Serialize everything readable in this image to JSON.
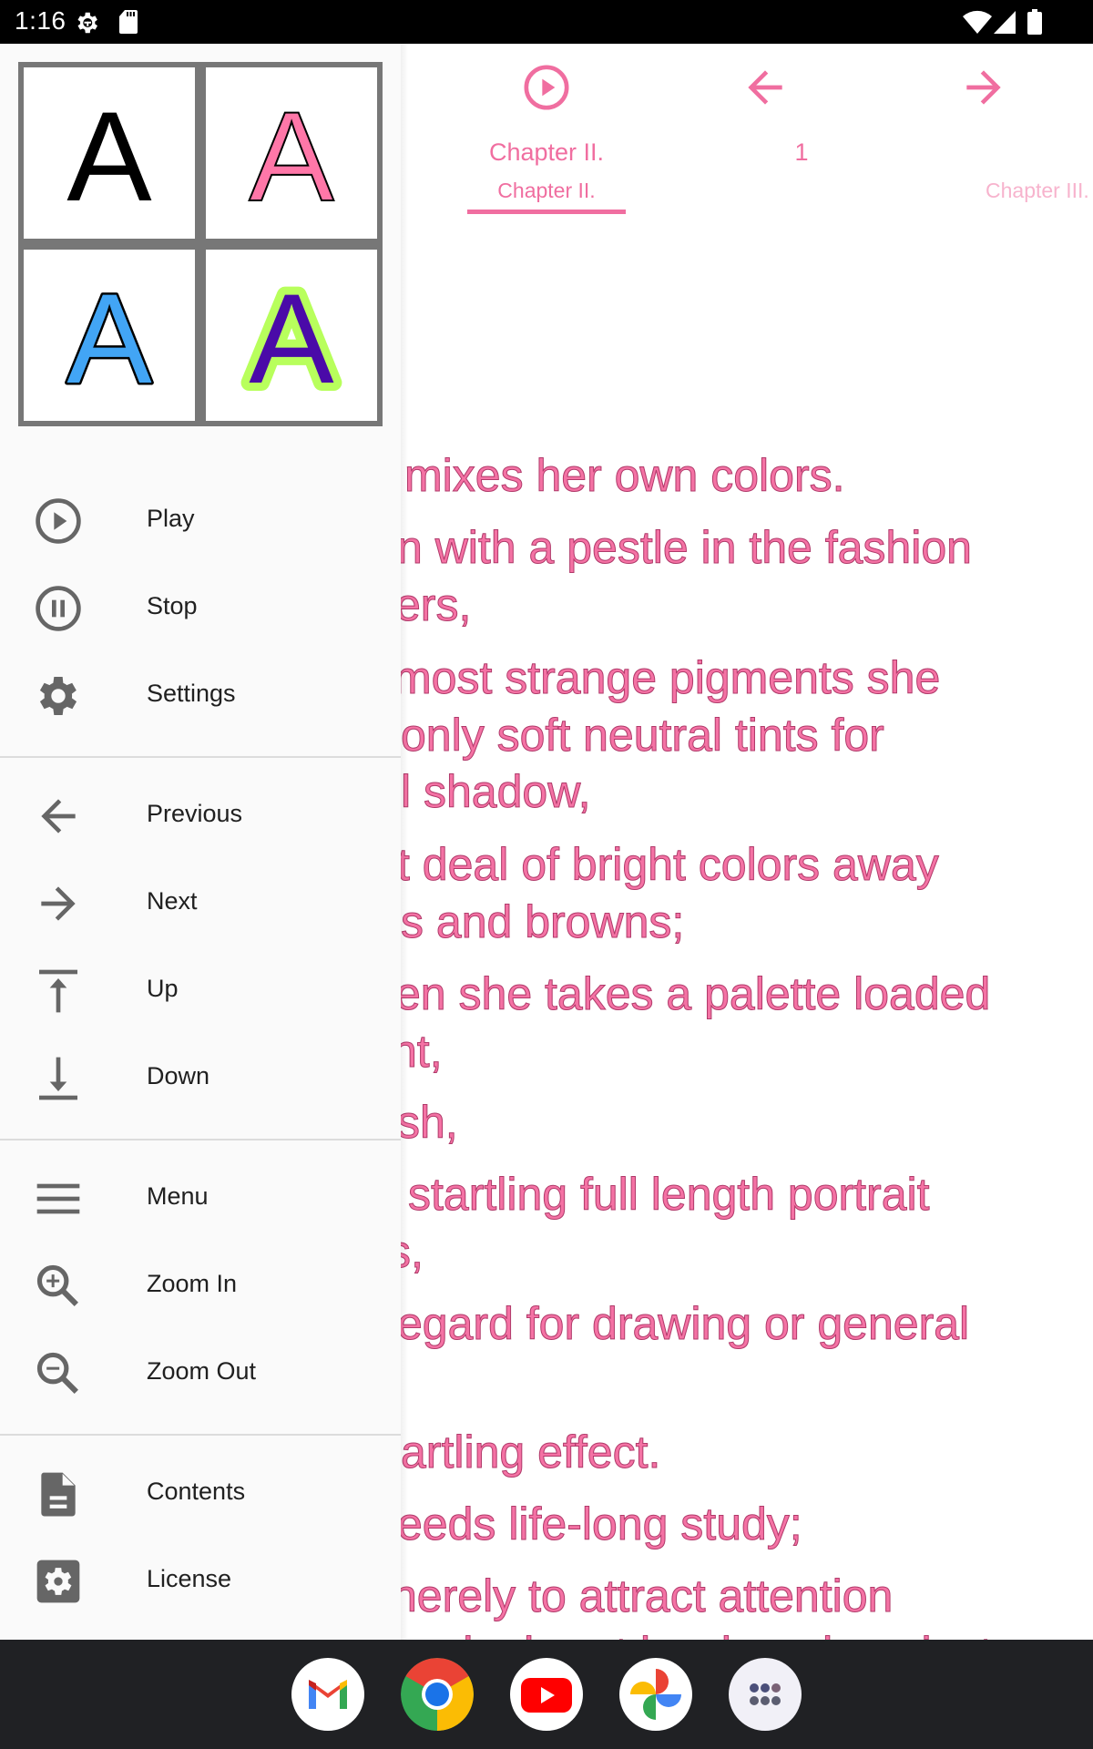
{
  "status_bar": {
    "time": "1:16",
    "left_icons": [
      "settings-gear-icon",
      "sd-card-icon"
    ],
    "right_icons": [
      "wifi-icon",
      "cell-signal-icon",
      "battery-icon"
    ]
  },
  "reader": {
    "accent_color": "#f06ea0",
    "tabs": [
      {
        "icon": "play-circle-icon",
        "title": "Chapter II.",
        "subtitle": "Chapter II.",
        "selected": true
      },
      {
        "icon": "arrow-left-icon",
        "title": "1",
        "subtitle": ""
      },
      {
        "icon": "arrow-right-icon",
        "title": "",
        "subtitle": "Chapter III."
      }
    ],
    "lines": [
      "mixes her own colors.",
      "n with a pestle in the fashion",
      "ers,",
      "most strange pigments she",
      "only soft neutral tints for",
      "l shadow,",
      "t deal of bright colors away",
      "s and browns;",
      "en she takes a palette loaded",
      "nt,",
      "sh,",
      "startling full length portrait",
      "s,",
      "egard for drawing or general",
      "artling effect.",
      "eeds life-long study;",
      "herely to attract attention",
      "and a heart hardened against"
    ]
  },
  "drawer": {
    "font_styles": [
      {
        "letter": "A",
        "fill": "#000000",
        "stroke": "none",
        "glow": "none"
      },
      {
        "letter": "A",
        "fill": "#ff77a8",
        "stroke": "#000000",
        "glow": "none"
      },
      {
        "letter": "A",
        "fill": "#42a5f5",
        "stroke": "#000000",
        "glow": "none"
      },
      {
        "letter": "A",
        "fill": "#4a0aa8",
        "stroke": "none",
        "glow": "#b8ff5c"
      }
    ],
    "groups": [
      [
        {
          "label": "Play",
          "icon": "play-circle-icon"
        },
        {
          "label": "Stop",
          "icon": "pause-circle-icon"
        },
        {
          "label": "Settings",
          "icon": "gear-icon"
        }
      ],
      [
        {
          "label": "Previous",
          "icon": "arrow-left-icon"
        },
        {
          "label": "Next",
          "icon": "arrow-right-icon"
        },
        {
          "label": "Up",
          "icon": "arrow-up-to-line-icon"
        },
        {
          "label": "Down",
          "icon": "arrow-down-to-line-icon"
        }
      ],
      [
        {
          "label": "Menu",
          "icon": "hamburger-menu-icon"
        },
        {
          "label": "Zoom In",
          "icon": "zoom-in-icon"
        },
        {
          "label": "Zoom Out",
          "icon": "zoom-out-icon"
        }
      ],
      [
        {
          "label": "Contents",
          "icon": "document-icon"
        },
        {
          "label": "License",
          "icon": "settings-box-icon"
        }
      ]
    ]
  },
  "dock": {
    "apps": [
      "Gmail",
      "Chrome",
      "YouTube",
      "Photos",
      "App drawer"
    ]
  }
}
